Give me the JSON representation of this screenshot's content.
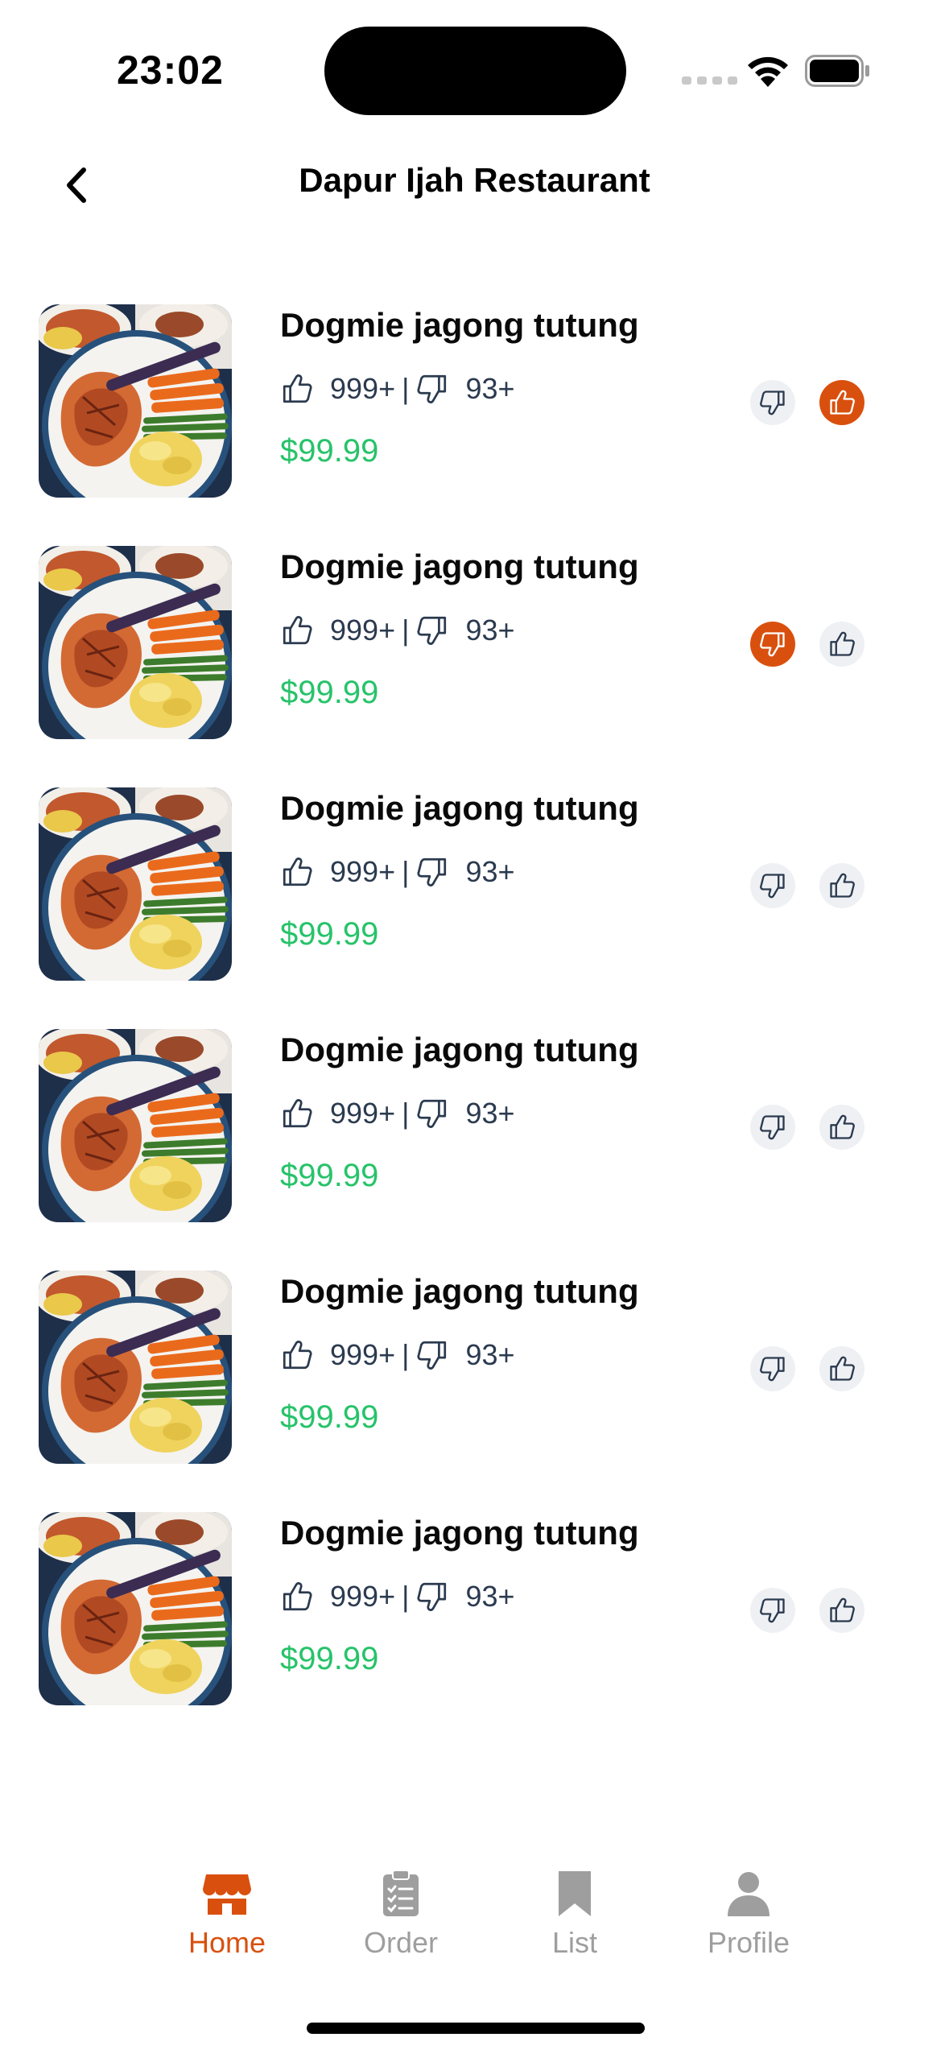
{
  "status_bar": {
    "time": "23:02"
  },
  "header": {
    "title": "Dapur Ijah Restaurant"
  },
  "items": [
    {
      "name": "Dogmie jagong tutung",
      "likes": "999+",
      "separator": "|",
      "dislikes": "93+",
      "price": "$99.99",
      "vote": "up"
    },
    {
      "name": "Dogmie jagong tutung",
      "likes": "999+",
      "separator": "|",
      "dislikes": "93+",
      "price": "$99.99",
      "vote": "down"
    },
    {
      "name": "Dogmie jagong tutung",
      "likes": "999+",
      "separator": "|",
      "dislikes": "93+",
      "price": "$99.99",
      "vote": "none"
    },
    {
      "name": "Dogmie jagong tutung",
      "likes": "999+",
      "separator": "|",
      "dislikes": "93+",
      "price": "$99.99",
      "vote": "none"
    },
    {
      "name": "Dogmie jagong tutung",
      "likes": "999+",
      "separator": "|",
      "dislikes": "93+",
      "price": "$99.99",
      "vote": "none"
    },
    {
      "name": "Dogmie jagong tutung",
      "likes": "999+",
      "separator": "|",
      "dislikes": "93+",
      "price": "$99.99",
      "vote": "none"
    }
  ],
  "tabs": [
    {
      "label": "Home",
      "icon": "store-icon",
      "active": true
    },
    {
      "label": "Order",
      "icon": "clipboard-icon",
      "active": false
    },
    {
      "label": "List",
      "icon": "bookmark-icon",
      "active": false
    },
    {
      "label": "Profile",
      "icon": "person-icon",
      "active": false
    }
  ],
  "colors": {
    "accent": "#d9500e",
    "price": "#27c36a",
    "text": "#2b3a4f",
    "inactive": "#9e9e9e"
  }
}
